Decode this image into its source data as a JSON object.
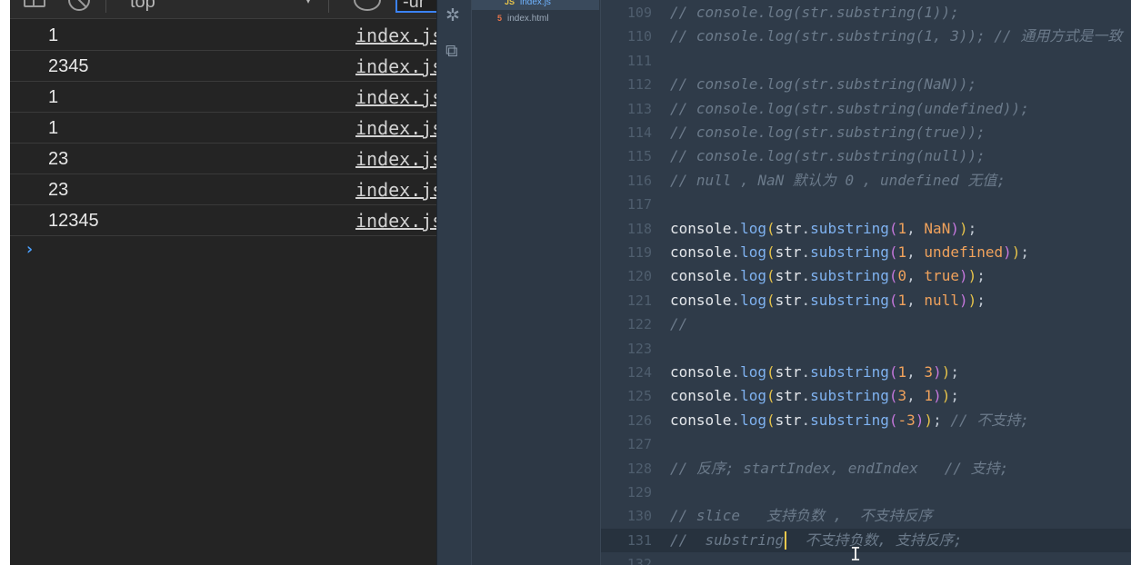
{
  "devtools": {
    "toolbar": {
      "context_label": "top",
      "filter_text": "-ur",
      "icons": [
        "sidebar-toggle-icon",
        "clear-console-icon",
        "dropdown-caret-icon",
        "live-expression-eye-icon"
      ]
    },
    "console_rows": [
      {
        "value": "1",
        "source": "index.js"
      },
      {
        "value": "2345",
        "source": "index.js"
      },
      {
        "value": "1",
        "source": "index.js"
      },
      {
        "value": "1",
        "source": "index.js"
      },
      {
        "value": "23",
        "source": "index.js"
      },
      {
        "value": "23",
        "source": "index.js"
      },
      {
        "value": "12345",
        "source": "index.js"
      }
    ],
    "prompt": "›"
  },
  "vscode": {
    "activity_icons": [
      "debug-icon",
      "extensions-icon"
    ],
    "explorer_files": [
      {
        "name": "index.js",
        "type": "JS",
        "active": true
      },
      {
        "name": "index.html",
        "type": "html",
        "active": false
      }
    ],
    "lines": [
      {
        "num": "109",
        "text": "// console.log(str.substring(1));",
        "comment": true
      },
      {
        "num": "110",
        "text": "// console.log(str.substring(1, 3)); // 通用方式是一致",
        "comment": true
      },
      {
        "num": "111",
        "text": "",
        "comment": true
      },
      {
        "num": "112",
        "text": "// console.log(str.substring(NaN));",
        "comment": true
      },
      {
        "num": "113",
        "text": "// console.log(str.substring(undefined));",
        "comment": true
      },
      {
        "num": "114",
        "text": "// console.log(str.substring(true));",
        "comment": true
      },
      {
        "num": "115",
        "text": "// console.log(str.substring(null));",
        "comment": true
      },
      {
        "num": "116",
        "text": "// null , NaN 默认为 0 , undefined 无值;",
        "comment": true
      },
      {
        "num": "117",
        "text": "",
        "comment": true
      },
      {
        "num": "118",
        "args": [
          "1",
          "NaN"
        ]
      },
      {
        "num": "119",
        "args": [
          "1",
          "undefined"
        ]
      },
      {
        "num": "120",
        "args": [
          "0",
          "true"
        ]
      },
      {
        "num": "121",
        "args": [
          "1",
          "null"
        ]
      },
      {
        "num": "122",
        "text": "//",
        "comment": true
      },
      {
        "num": "123",
        "text": "",
        "comment": true
      },
      {
        "num": "124",
        "args": [
          "1",
          "3"
        ]
      },
      {
        "num": "125",
        "args": [
          "3",
          "1"
        ]
      },
      {
        "num": "126",
        "args": [
          "-3"
        ],
        "trailing": " // 不支持;"
      },
      {
        "num": "127",
        "text": "",
        "comment": true
      },
      {
        "num": "128",
        "text": "// 反序; startIndex, endIndex   // 支持;",
        "comment": true
      },
      {
        "num": "129",
        "text": "",
        "comment": true
      },
      {
        "num": "130",
        "text": "// slice   支持负数 ,  不支持反序",
        "comment": true
      },
      {
        "num": "131",
        "text_before_caret": "//  substring",
        "text_after_caret": "  不支持负数, 支持反序;",
        "comment": true,
        "current": true
      },
      {
        "num": "132",
        "text": "",
        "comment": true
      }
    ],
    "call_object": "console",
    "call_method": "log",
    "inner_object": "str",
    "inner_method": "substring"
  }
}
